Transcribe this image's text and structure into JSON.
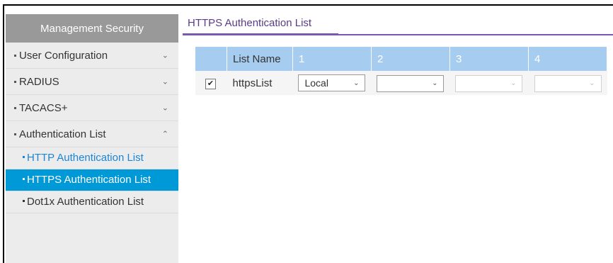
{
  "sidebar": {
    "header": "Management Security",
    "items": [
      {
        "label": "User Configuration",
        "chevron": "chevron-down"
      },
      {
        "label": "RADIUS",
        "chevron": "chevron-down"
      },
      {
        "label": "TACACS+",
        "chevron": "chevron-down"
      },
      {
        "label": "Authentication List",
        "chevron": "chevron-up"
      }
    ],
    "subitems": [
      {
        "label": "HTTP Authentication List",
        "state": "link"
      },
      {
        "label": "HTTPS Authentication List",
        "state": "active"
      },
      {
        "label": "Dot1x Authentication List",
        "state": "normal"
      }
    ]
  },
  "main": {
    "title": "HTTPS Authentication List",
    "table": {
      "headers": [
        "",
        "List Name",
        "1",
        "2",
        "3",
        "4"
      ],
      "rows": [
        {
          "checked": true,
          "name": "httpsList",
          "methods": [
            "Local",
            "",
            "",
            ""
          ]
        }
      ]
    }
  },
  "colors": {
    "active_bg": "#0099d8",
    "link": "#1a86d8",
    "header_bg": "#999999",
    "table_header": "#a6cdef",
    "title_accent": "#7a58b0"
  }
}
